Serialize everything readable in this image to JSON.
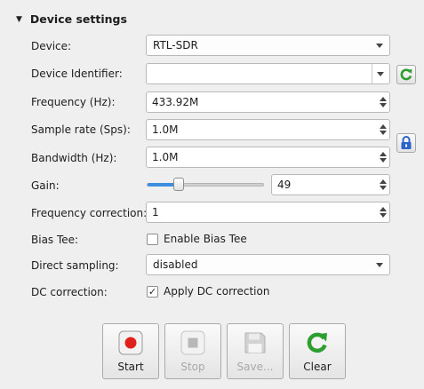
{
  "section": {
    "title": "Device settings"
  },
  "fields": {
    "device": {
      "label": "Device:",
      "value": "RTL-SDR"
    },
    "device_identifier": {
      "label": "Device Identifier:",
      "value": ""
    },
    "frequency": {
      "label": "Frequency (Hz):",
      "value": "433.92M"
    },
    "sample_rate": {
      "label": "Sample rate (Sps):",
      "value": "1.0M"
    },
    "bandwidth": {
      "label": "Bandwidth (Hz):",
      "value": "1.0M"
    },
    "gain": {
      "label": "Gain:",
      "value": "49",
      "slider_fraction": 0.27
    },
    "frequency_correction": {
      "label": "Frequency correction:",
      "value": "1"
    },
    "bias_tee": {
      "label": "Bias Tee:",
      "checkbox_label": "Enable Bias Tee",
      "checked": false
    },
    "direct_sampling": {
      "label": "Direct sampling:",
      "value": "disabled"
    },
    "dc_correction": {
      "label": "DC correction:",
      "checkbox_label": "Apply DC correction",
      "checked": true
    }
  },
  "side_buttons": {
    "refresh_icon": "refresh-icon",
    "lock_icon": "lock-icon"
  },
  "toolbar": {
    "start_label": "Start",
    "stop_label": "Stop",
    "save_label": "Save...",
    "clear_label": "Clear"
  },
  "colors": {
    "accent": "#3d8ee0",
    "record_red": "#e0201c",
    "refresh_green": "#2e9e2e",
    "lock_blue": "#2a64c8"
  }
}
